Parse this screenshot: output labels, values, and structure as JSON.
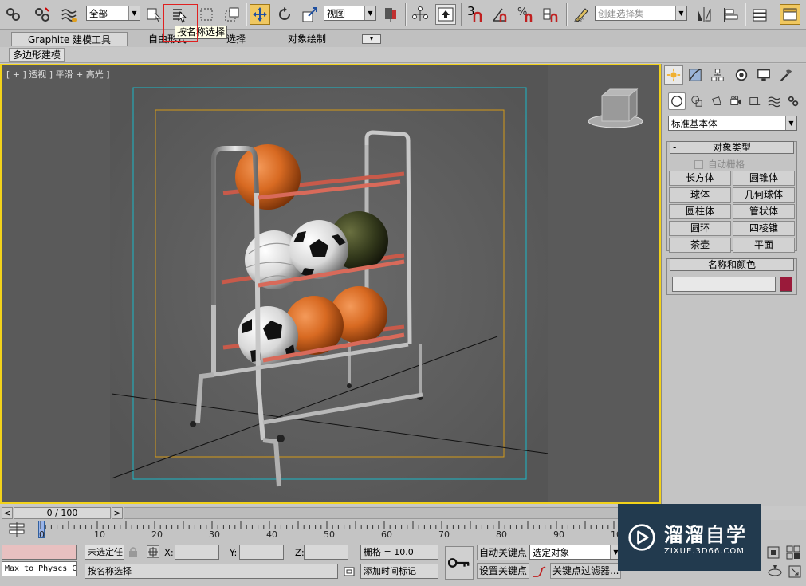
{
  "toolbar": {
    "selection_filter": "全部",
    "reference_coord": "视图",
    "named_selection_placeholder": "创建选择集",
    "snap_3d_label": "3"
  },
  "tooltip": {
    "text": "按名称选择"
  },
  "ribbon": {
    "tabs": [
      "Graphite 建模工具",
      "自由形式",
      "选择",
      "对象绘制"
    ],
    "subtab": "多边形建模"
  },
  "viewport": {
    "label": "[ + ] 透视 ] 平滑 + 高光 ]",
    "scene": "ball-rack-with-balls"
  },
  "command_panel": {
    "category_dropdown": "标准基本体",
    "object_type": {
      "title": "对象类型",
      "autogrid_label": "自动栅格",
      "buttons": [
        [
          "长方体",
          "圆锥体"
        ],
        [
          "球体",
          "几何球体"
        ],
        [
          "圆柱体",
          "管状体"
        ],
        [
          "圆环",
          "四棱锥"
        ],
        [
          "茶壶",
          "平面"
        ]
      ]
    },
    "name_color": {
      "title": "名称和颜色",
      "name_value": "",
      "swatch_color": "#9a1a3a"
    }
  },
  "timeline": {
    "frame_counter": "0 / 100",
    "prev_label": "<",
    "next_label": ">",
    "ticks": [
      "0",
      "10",
      "20",
      "30",
      "40",
      "50",
      "60",
      "70",
      "80",
      "90",
      "10"
    ]
  },
  "status_bar": {
    "maxscript_listener": "Max to Physcs C",
    "selection_status": "未选定任",
    "x_label": "X:",
    "y_label": "Y:",
    "z_label": "Z:",
    "grid": "栅格 = 10.0",
    "auto_key": "自动关键点",
    "set_key": "设置关键点",
    "selected_object": "选定对象",
    "key_filters": "关键点过滤器...",
    "prompt": "按名称选择",
    "add_time_tag": "添加时间标记"
  },
  "watermark": {
    "title": "溜溜自学",
    "url": "ZIXUE.3D66.COM"
  }
}
